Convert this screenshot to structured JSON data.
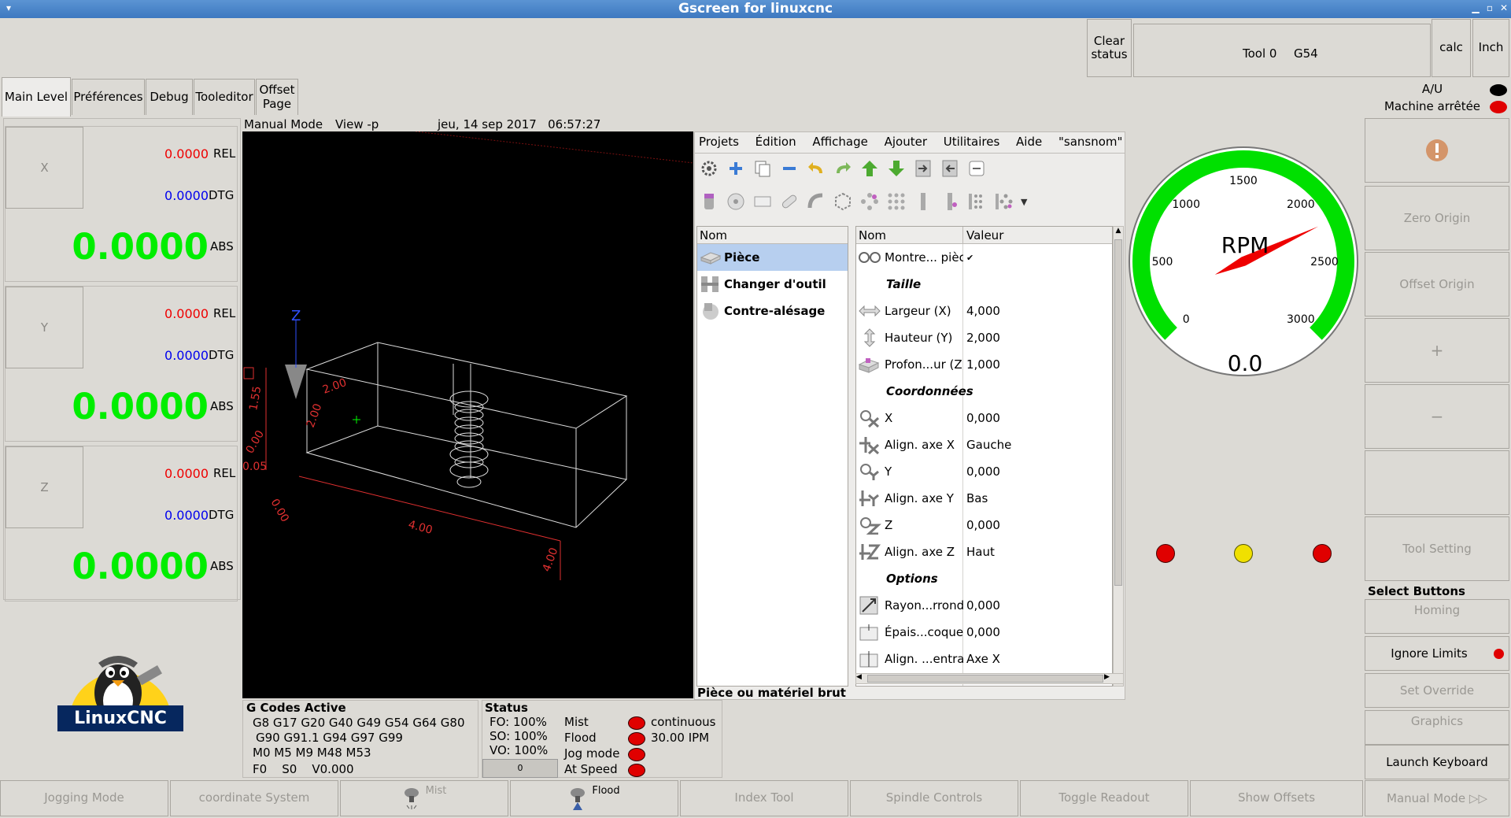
{
  "window": {
    "title": "Gscreen for linuxcnc"
  },
  "top": {
    "clear_status": "Clear status",
    "tool": "Tool 0",
    "system": "G54",
    "calc": "calc",
    "units": "Inch"
  },
  "tabs": [
    "Main Level",
    "Préférences",
    "Debug",
    "Tooleditor",
    "Offset Page"
  ],
  "status_right": {
    "au": "A/U",
    "machine": "Machine arrêtée"
  },
  "dro": [
    {
      "axis": "X",
      "rel": "0.0000",
      "rel_label": "REL",
      "dtg": "0.0000",
      "dtg_label": "DTG",
      "abs": "0.0000",
      "abs_label": "ABS"
    },
    {
      "axis": "Y",
      "rel": "0.0000",
      "rel_label": "REL",
      "dtg": "0.0000",
      "dtg_label": "DTG",
      "abs": "0.0000",
      "abs_label": "ABS"
    },
    {
      "axis": "Z",
      "rel": "0.0000",
      "rel_label": "REL",
      "dtg": "0.0000",
      "dtg_label": "DTG",
      "abs": "0.0000",
      "abs_label": "ABS"
    }
  ],
  "logo": {
    "text": "LinuxCNC"
  },
  "preview": {
    "mode": "Manual Mode",
    "view": "View -p",
    "datetime": "jeu, 14 sep 2017   06:57:27",
    "dims": {
      "width": "4.00",
      "depth": "2.00",
      "z": "1.55",
      "a": "2.00",
      "b": "0.00",
      "c": "0.05",
      "d": "0.00",
      "e": "4.00",
      "axis_z": "Z"
    }
  },
  "editor": {
    "menu": [
      "Projets",
      "Édition",
      "Affichage",
      "Ajouter",
      "Utilitaires",
      "Aide",
      "\"sansnom\""
    ],
    "tree_header": "Nom",
    "tree": [
      {
        "label": "Pièce",
        "icon": "stock-icon",
        "selected": true
      },
      {
        "label": "Changer d'outil",
        "icon": "toolchange-icon",
        "selected": false
      },
      {
        "label": "Contre-alésage",
        "icon": "counterbore-icon",
        "selected": false
      }
    ],
    "props_header": {
      "name": "Nom",
      "value": "Valeur"
    },
    "props": [
      {
        "type": "row",
        "name": "Montre... pièce",
        "value": "✔",
        "icon": "glasses-icon"
      },
      {
        "type": "section",
        "name": "Taille"
      },
      {
        "type": "row",
        "name": "Largeur (X)",
        "value": "4,000",
        "icon": "width-icon"
      },
      {
        "type": "row",
        "name": "Hauteur (Y)",
        "value": "2,000",
        "icon": "height-icon"
      },
      {
        "type": "row",
        "name": "Profon...ur (Z)",
        "value": "1,000",
        "icon": "depth-icon"
      },
      {
        "type": "section",
        "name": "Coordonnées"
      },
      {
        "type": "row",
        "name": "X",
        "value": "0,000",
        "icon": "coord-x-icon"
      },
      {
        "type": "row",
        "name": "Align. axe X",
        "value": "Gauche",
        "icon": "align-x-icon"
      },
      {
        "type": "row",
        "name": "Y",
        "value": "0,000",
        "icon": "coord-y-icon"
      },
      {
        "type": "row",
        "name": "Align. axe Y",
        "value": "Bas",
        "icon": "align-y-icon"
      },
      {
        "type": "row",
        "name": "Z",
        "value": "0,000",
        "icon": "coord-z-icon"
      },
      {
        "type": "row",
        "name": "Align. axe Z",
        "value": "Haut",
        "icon": "align-z-icon"
      },
      {
        "type": "section",
        "name": "Options"
      },
      {
        "type": "row",
        "name": "Rayon...rrondi",
        "value": "0,000",
        "icon": "radius-icon"
      },
      {
        "type": "row",
        "name": "Épais...coque",
        "value": "0,000",
        "icon": "thickness-icon"
      },
      {
        "type": "row",
        "name": "Align. ...entral",
        "value": "Axe X",
        "icon": "align-center-icon"
      }
    ],
    "status": "Pièce ou matériel brut"
  },
  "gauge": {
    "label": "RPM",
    "value": "0.0",
    "ticks": [
      "0",
      "500",
      "1000",
      "1500",
      "2000",
      "2500",
      "3000"
    ],
    "max": 3000,
    "needle": 0,
    "color": "#00e000"
  },
  "right_buttons": {
    "zero_origin": "Zero Origin",
    "offset_origin": "Offset Origin",
    "plus": "+",
    "minus": "−",
    "tool_setting": "Tool Setting",
    "select_title": "Select Buttons",
    "homing": "Homing",
    "ignore_limits": "Ignore Limits",
    "set_override": "Set Override",
    "graphics": "Graphics",
    "launch_keyboard": "Launch Keyboard",
    "manual_mode": "Manual Mode ▷▷"
  },
  "gcodes": {
    "title": "G Codes Active",
    "line1": "G8 G17 G20 G40 G49 G54 G64 G80",
    "line2": "G90 G91.1 G94 G97 G99",
    "line3": "M0 M5 M9 M48 M53",
    "line4": "F0    S0    V0.000"
  },
  "status_panel": {
    "title": "Status",
    "fo": "FO: 100%",
    "so": "SO: 100%",
    "vo": "VO: 100%",
    "spin": "0",
    "mist": "Mist",
    "flood": "Flood",
    "jog": "Jog mode",
    "at_speed": "At Speed",
    "continuous": "continuous",
    "ipm": "30.00 IPM"
  },
  "bottom": [
    "Jogging Mode",
    "coordinate System",
    "Mist",
    "Flood",
    "Index Tool",
    "Spindle Controls",
    "Toggle Readout",
    "Show Offsets"
  ]
}
